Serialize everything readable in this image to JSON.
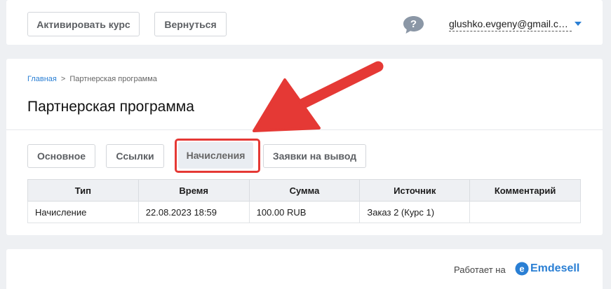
{
  "topbar": {
    "activate_label": "Активировать курс",
    "back_label": "Вернуться",
    "help_icon": "question-bubble-icon",
    "user_email": "glushko.evgeny@gmail.com",
    "user_caret_icon": "caret-down-icon"
  },
  "breadcrumb": {
    "home": "Главная",
    "separator": ">",
    "current": "Партнерская программа"
  },
  "page": {
    "title": "Партнерская программа"
  },
  "tabs": [
    {
      "label": "Основное",
      "active": false
    },
    {
      "label": "Ссылки",
      "active": false
    },
    {
      "label": "Начисления",
      "active": true
    },
    {
      "label": "Заявки на вывод",
      "active": false
    }
  ],
  "table": {
    "columns": [
      "Тип",
      "Время",
      "Сумма",
      "Источник",
      "Комментарий"
    ],
    "rows": [
      [
        "Начисление",
        "22.08.2023 18:59",
        "100.00 RUB",
        "Заказ 2 (Курс 1)",
        ""
      ]
    ]
  },
  "footer": {
    "powered_by": "Работает на",
    "brand": "Emdesell",
    "brand_icon": "emdesell-logo-icon"
  },
  "colors": {
    "accent": "#2a7fd4",
    "annotation_red": "#e53935",
    "background": "#eef0f3"
  }
}
